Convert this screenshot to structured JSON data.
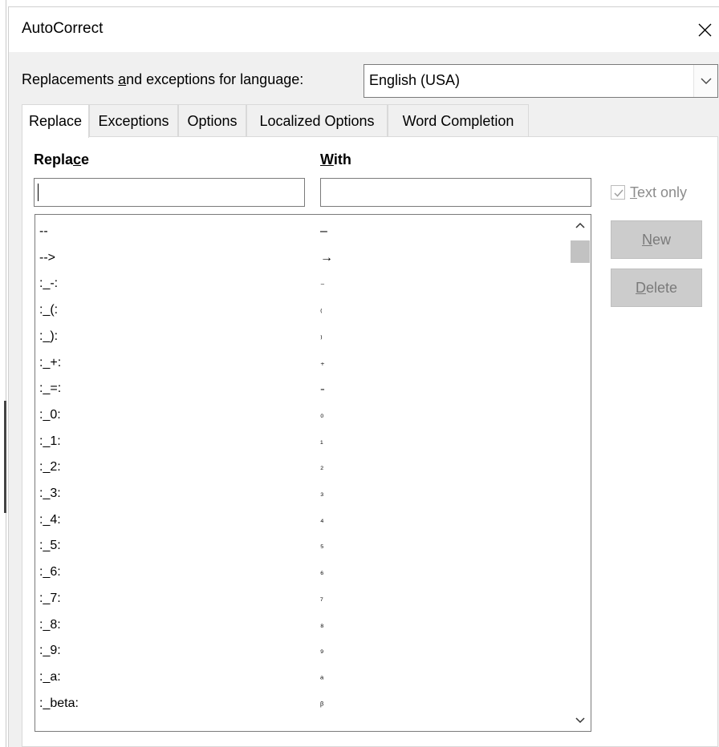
{
  "window": {
    "title": "AutoCorrect"
  },
  "language": {
    "label_pre": "Replacements ",
    "label_accel": "a",
    "label_post": "nd exceptions for language:",
    "selected": "English (USA)"
  },
  "tabs": [
    {
      "label": "Replace"
    },
    {
      "label": "Exceptions"
    },
    {
      "label": "Options"
    },
    {
      "label": "Localized Options"
    },
    {
      "label": "Word Completion"
    }
  ],
  "replace_tab": {
    "replace_header_pre": "Repla",
    "replace_header_accel": "c",
    "replace_header_post": "e",
    "with_header_accel": "W",
    "with_header_post": "ith",
    "replace_value": "",
    "with_value": "",
    "text_only_accel": "T",
    "text_only_post": "ext only",
    "text_only_checked": true,
    "new_accel": "N",
    "new_post": "ew",
    "delete_accel": "D",
    "delete_post": "elete"
  },
  "entries": [
    {
      "replace": "--",
      "with": "–"
    },
    {
      "replace": "-->",
      "with": "→"
    },
    {
      "replace": ":_-:",
      "with": "₋"
    },
    {
      "replace": ":_(:",
      "with": "₍"
    },
    {
      "replace": ":_):",
      "with": "₎"
    },
    {
      "replace": ":_+:",
      "with": "₊"
    },
    {
      "replace": ":_=:",
      "with": "₌"
    },
    {
      "replace": ":_0:",
      "with": "₀"
    },
    {
      "replace": ":_1:",
      "with": "₁"
    },
    {
      "replace": ":_2:",
      "with": "₂"
    },
    {
      "replace": ":_3:",
      "with": "₃"
    },
    {
      "replace": ":_4:",
      "with": "₄"
    },
    {
      "replace": ":_5:",
      "with": "₅"
    },
    {
      "replace": ":_6:",
      "with": "₆"
    },
    {
      "replace": ":_7:",
      "with": "₇"
    },
    {
      "replace": ":_8:",
      "with": "₈"
    },
    {
      "replace": ":_9:",
      "with": "₉"
    },
    {
      "replace": ":_a:",
      "with": "ₐ"
    },
    {
      "replace": ":_beta:",
      "with": "ᵦ"
    }
  ]
}
